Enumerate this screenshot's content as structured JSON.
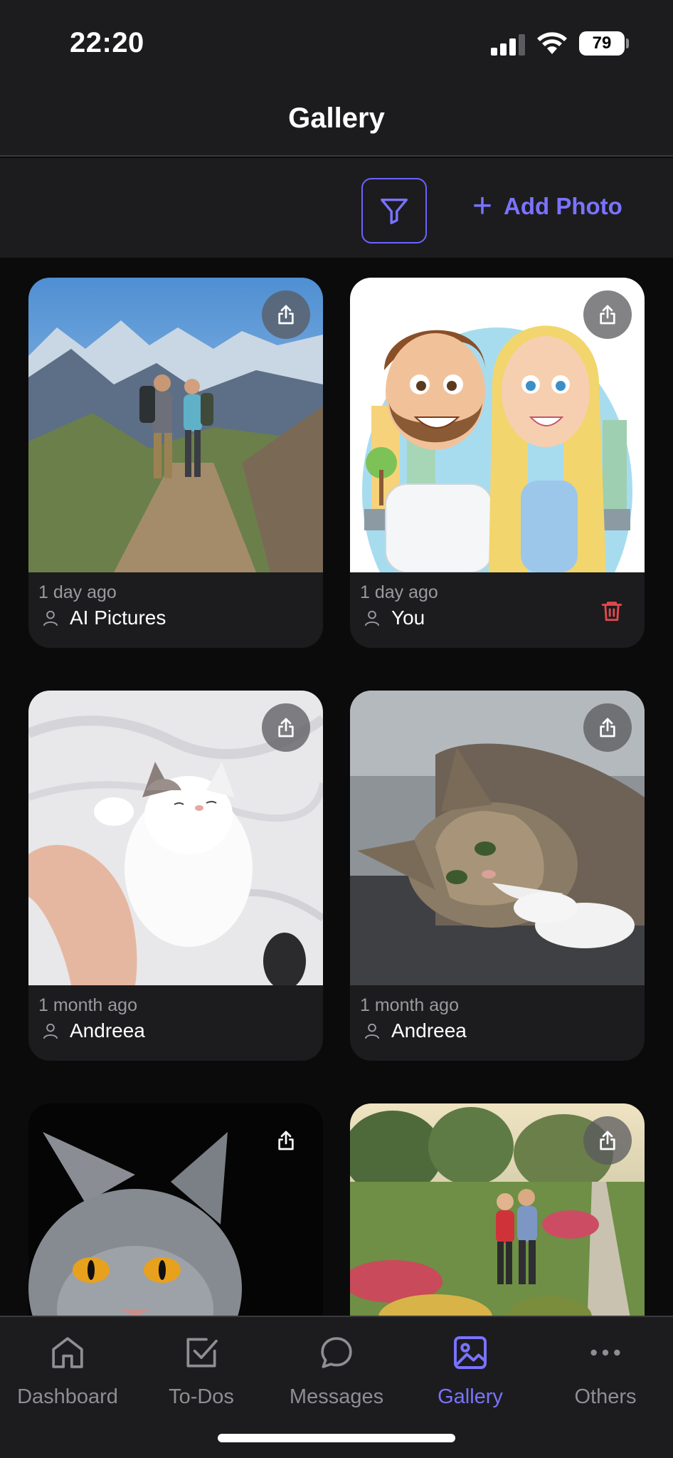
{
  "status_bar": {
    "time": "22:20",
    "battery_level": "79",
    "icons": [
      "signal-icon",
      "wifi-icon",
      "battery-icon"
    ]
  },
  "header": {
    "title": "Gallery"
  },
  "toolbar": {
    "filter_icon": "filter-icon",
    "add_photo_label": "Add Photo",
    "accent_color": "#7a73ff"
  },
  "gallery": {
    "items": [
      {
        "time": "1 day ago",
        "author": "AI Pictures",
        "can_delete": false,
        "photo": "couple hiking on mountain trail"
      },
      {
        "time": "1 day ago",
        "author": "You",
        "can_delete": true,
        "photo": "cartoon couple illustration"
      },
      {
        "time": "1 month ago",
        "author": "Andreea",
        "can_delete": false,
        "photo": "white kitten sleeping on hand"
      },
      {
        "time": "1 month ago",
        "author": "Andreea",
        "can_delete": false,
        "photo": "tabby kitten lying down"
      },
      {
        "time": "",
        "author": "",
        "can_delete": false,
        "photo": "grey cat with yellow eyes"
      },
      {
        "time": "",
        "author": "",
        "can_delete": false,
        "photo": "couple in flower garden"
      }
    ]
  },
  "tab_bar": {
    "active": "Gallery",
    "tabs": [
      {
        "label": "Dashboard",
        "icon": "home-icon"
      },
      {
        "label": "To-Dos",
        "icon": "checkbox-icon"
      },
      {
        "label": "Messages",
        "icon": "chat-bubble-icon"
      },
      {
        "label": "Gallery",
        "icon": "image-icon"
      },
      {
        "label": "Others",
        "icon": "more-icon"
      }
    ]
  }
}
